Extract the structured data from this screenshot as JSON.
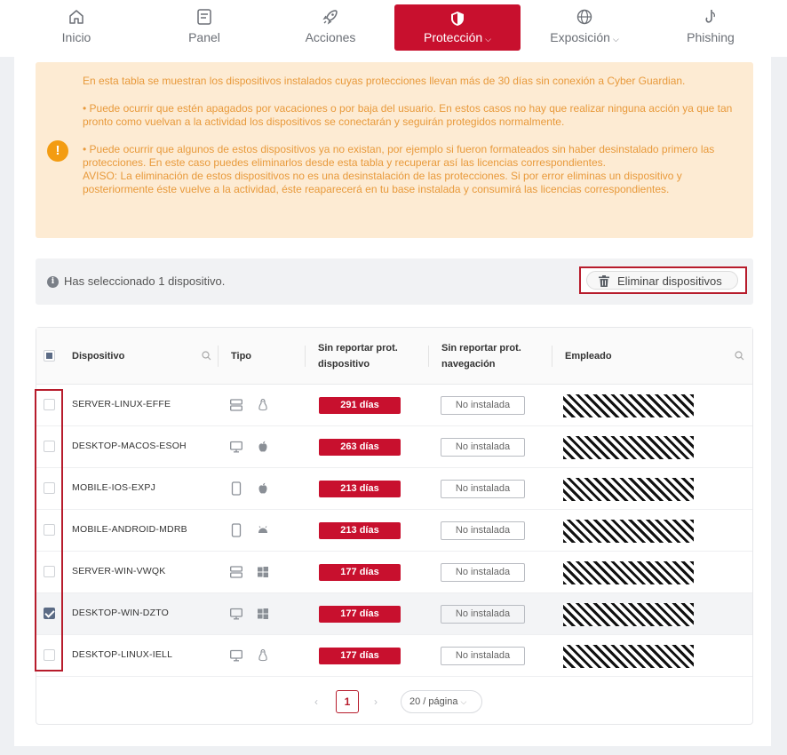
{
  "nav": {
    "items": [
      {
        "label": "Inicio",
        "icon": "home-icon"
      },
      {
        "label": "Panel",
        "icon": "panel-icon"
      },
      {
        "label": "Acciones",
        "icon": "rocket-icon"
      },
      {
        "label": "Protección",
        "icon": "shield-icon",
        "active": true,
        "dropdown": true
      },
      {
        "label": "Exposición",
        "icon": "globe-icon",
        "dropdown": true
      },
      {
        "label": "Phishing",
        "icon": "hook-icon"
      }
    ]
  },
  "alert": {
    "icon": "warning-icon",
    "p1": "En esta tabla se muestran los dispositivos instalados cuyas protecciones llevan más de 30 días sin conexión a Cyber Guardian.",
    "p2": "• Puede ocurrir que estén apagados por vacaciones o por baja del usuario. En estos casos no hay que realizar ninguna acción ya que tan pronto como vuelvan a la actividad los dispositivos se conectarán y seguirán protegidos normalmente.",
    "p3a": "• Puede ocurrir que algunos de estos dispositivos ya no existan, por ejemplo si fueron formateados sin haber desinstalado primero las protecciones. En este caso puedes eliminarlos desde esta tabla y recuperar así las licencias correspondientes.",
    "p3b": "AVISO: La eliminación de estos dispositivos no es una desinstalación de las protecciones. Si por error eliminas un dispositivo y posteriormente éste vuelve a la actividad, éste reaparecerá en tu base instalada y consumirá las licencias correspondientes."
  },
  "selection": {
    "text": "Has seleccionado 1 dispositivo.",
    "delete_label": "Eliminar dispositivos"
  },
  "table": {
    "headers": {
      "device": "Dispositivo",
      "type": "Tipo",
      "prot_device_1": "Sin reportar prot.",
      "prot_device_2": "dispositivo",
      "prot_nav_1": "Sin reportar prot.",
      "prot_nav_2": "navegación",
      "employee": "Empleado"
    },
    "rows": [
      {
        "name": "SERVER-LINUX-EFFE",
        "type_icon": "server-icon",
        "os_icon": "linux-icon",
        "days": "291 días",
        "nav": "No instalada",
        "checked": false
      },
      {
        "name": "DESKTOP-MACOS-ESOH",
        "type_icon": "desktop-icon",
        "os_icon": "apple-icon",
        "days": "263 días",
        "nav": "No instalada",
        "checked": false
      },
      {
        "name": "MOBILE-IOS-EXPJ",
        "type_icon": "mobile-icon",
        "os_icon": "apple-icon",
        "days": "213 días",
        "nav": "No instalada",
        "checked": false
      },
      {
        "name": "MOBILE-ANDROID-MDRB",
        "type_icon": "mobile-icon",
        "os_icon": "android-icon",
        "days": "213 días",
        "nav": "No instalada",
        "checked": false
      },
      {
        "name": "SERVER-WIN-VWQK",
        "type_icon": "server-icon",
        "os_icon": "windows-icon",
        "days": "177 días",
        "nav": "No instalada",
        "checked": false
      },
      {
        "name": "DESKTOP-WIN-DZTO",
        "type_icon": "desktop-icon",
        "os_icon": "windows-icon",
        "days": "177 días",
        "nav": "No instalada",
        "checked": true
      },
      {
        "name": "DESKTOP-LINUX-IELL",
        "type_icon": "desktop-icon",
        "os_icon": "linux-icon",
        "days": "177 días",
        "nav": "No instalada",
        "checked": false
      }
    ]
  },
  "pagination": {
    "prev": "‹",
    "page": "1",
    "next": "›",
    "page_size": "20 / página"
  },
  "colors": {
    "accent": "#c8102e",
    "alert_bg": "#fdebd3",
    "alert_text": "#e89a3c",
    "warning": "#f39c12"
  }
}
